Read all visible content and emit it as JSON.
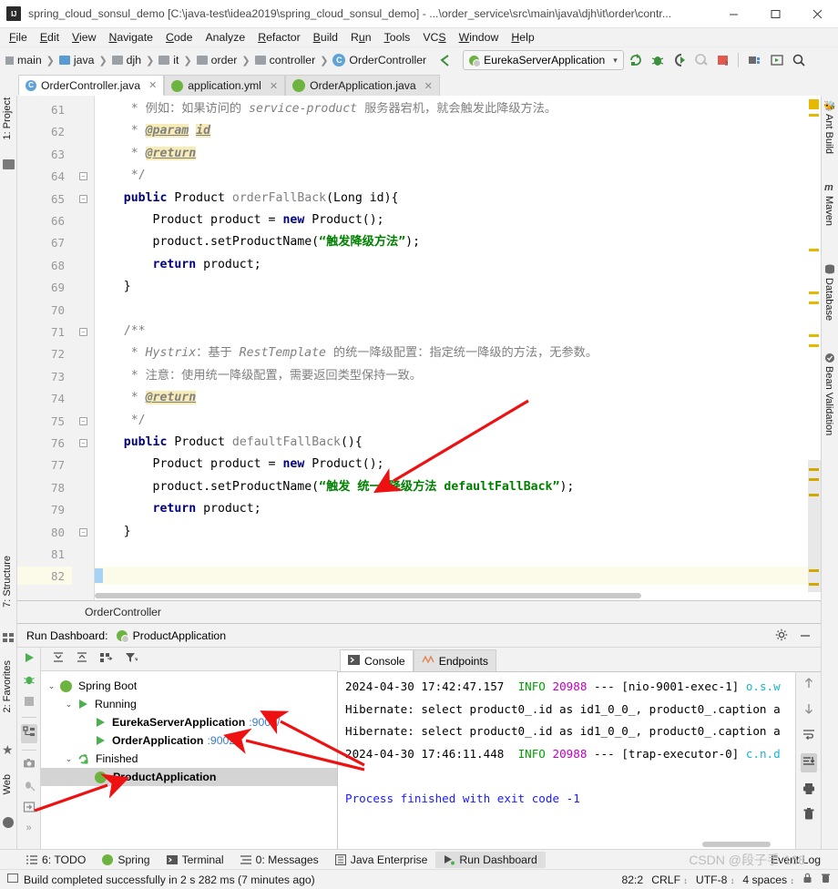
{
  "window": {
    "title": "spring_cloud_sonsul_demo [C:\\java-test\\idea2019\\spring_cloud_sonsul_demo] - ...\\order_service\\src\\main\\java\\djh\\it\\order\\contr...",
    "app_icon": "IJ",
    "minimize": "minimize-icon",
    "maximize": "maximize-icon",
    "close": "close-icon"
  },
  "menubar": [
    "File",
    "Edit",
    "View",
    "Navigate",
    "Code",
    "Analyze",
    "Refactor",
    "Build",
    "Run",
    "Tools",
    "VCS",
    "Window",
    "Help"
  ],
  "breadcrumbs": [
    {
      "label": "main",
      "icon": "module-icon"
    },
    {
      "label": "java",
      "icon": "source-folder-icon"
    },
    {
      "label": "djh",
      "icon": "package-icon"
    },
    {
      "label": "it",
      "icon": "package-icon"
    },
    {
      "label": "order",
      "icon": "package-icon"
    },
    {
      "label": "controller",
      "icon": "package-icon"
    },
    {
      "label": "OrderController",
      "icon": "class-icon"
    }
  ],
  "run_config": {
    "selected": "EurekaServerApplication",
    "caret": "⌄"
  },
  "toolbar_icons": [
    "rerun-icon",
    "debug-icon",
    "run-with-coverage-icon",
    "profile-icon",
    "stop-icon",
    "build-project-icon",
    "run-dashboard-icon",
    "search-everywhere-icon"
  ],
  "editor_tabs": [
    {
      "label": "OrderController.java",
      "icon": "java-class-icon",
      "active": true
    },
    {
      "label": "application.yml",
      "icon": "spring-yaml-icon",
      "active": false
    },
    {
      "label": "OrderApplication.java",
      "icon": "spring-boot-class-icon",
      "active": false
    }
  ],
  "left_rail": [
    {
      "label": "1: Project",
      "icon": "project-icon"
    },
    {
      "label": "7: Structure",
      "icon": "structure-icon"
    },
    {
      "label": "2: Favorites",
      "icon": "star-icon"
    },
    {
      "label": "Web",
      "icon": "web-icon"
    }
  ],
  "right_rail": [
    {
      "label": "Ant Build",
      "icon": "ant-icon"
    },
    {
      "label": "Maven",
      "icon": "maven-icon"
    },
    {
      "label": "Database",
      "icon": "database-icon"
    },
    {
      "label": "Bean Validation",
      "icon": "bean-validation-icon"
    }
  ],
  "editor": {
    "first_line_number": 61,
    "last_line_number": 82,
    "caret_line": 82,
    "lines": [
      {
        "n": 61,
        "segments": [
          {
            "t": "     * ",
            "c": "cm"
          },
          {
            "t": "例如：如果访问的 ",
            "c": "cm"
          },
          {
            "t": "service-product",
            "c": "cmi"
          },
          {
            "t": " 服务器宕机，就会触发此降级方法。",
            "c": "cm"
          }
        ]
      },
      {
        "n": 62,
        "segments": [
          {
            "t": "     * ",
            "c": "cm"
          },
          {
            "t": "@param",
            "c": "tag"
          },
          {
            "t": " ",
            "c": "cm"
          },
          {
            "t": "id",
            "c": "tagb"
          }
        ]
      },
      {
        "n": 63,
        "segments": [
          {
            "t": "     * ",
            "c": "cm"
          },
          {
            "t": "@return",
            "c": "tag"
          }
        ]
      },
      {
        "n": 64,
        "segments": [
          {
            "t": "     */",
            "c": "cm"
          }
        ]
      },
      {
        "n": 65,
        "segments": [
          {
            "t": "    ",
            "c": "id"
          },
          {
            "t": "public",
            "c": "k"
          },
          {
            "t": " Product ",
            "c": "id"
          },
          {
            "t": "orderFallBack",
            "c": "cm"
          },
          {
            "t": "(Long id){",
            "c": "id"
          }
        ]
      },
      {
        "n": 66,
        "segments": [
          {
            "t": "        Product product = ",
            "c": "id"
          },
          {
            "t": "new",
            "c": "k"
          },
          {
            "t": " Product();",
            "c": "id"
          }
        ]
      },
      {
        "n": 67,
        "segments": [
          {
            "t": "        product.setProductName(",
            "c": "id"
          },
          {
            "t": "“触发降级方法”",
            "c": "str"
          },
          {
            "t": ");",
            "c": "id"
          }
        ]
      },
      {
        "n": 68,
        "segments": [
          {
            "t": "        ",
            "c": "id"
          },
          {
            "t": "return",
            "c": "k"
          },
          {
            "t": " product;",
            "c": "id"
          }
        ]
      },
      {
        "n": 69,
        "segments": [
          {
            "t": "    }",
            "c": "id"
          }
        ]
      },
      {
        "n": 70,
        "segments": []
      },
      {
        "n": 71,
        "segments": [
          {
            "t": "    /**",
            "c": "cm"
          }
        ]
      },
      {
        "n": 72,
        "segments": [
          {
            "t": "     * ",
            "c": "cm"
          },
          {
            "t": "Hystrix",
            "c": "cmi"
          },
          {
            "t": "：基于 ",
            "c": "cm"
          },
          {
            "t": "RestTemplate",
            "c": "cmi"
          },
          {
            "t": " 的统一降级配置：指定统一降级的方法，无参数。",
            "c": "cm"
          }
        ]
      },
      {
        "n": 73,
        "segments": [
          {
            "t": "     * 注意：使用统一降级配置，需要返回类型保持一致。",
            "c": "cm"
          }
        ]
      },
      {
        "n": 74,
        "segments": [
          {
            "t": "     * ",
            "c": "cm"
          },
          {
            "t": "@return",
            "c": "tag"
          }
        ]
      },
      {
        "n": 75,
        "segments": [
          {
            "t": "     */",
            "c": "cm"
          }
        ]
      },
      {
        "n": 76,
        "segments": [
          {
            "t": "    ",
            "c": "id"
          },
          {
            "t": "public",
            "c": "k"
          },
          {
            "t": " Product ",
            "c": "id"
          },
          {
            "t": "defaultFallBack",
            "c": "cm"
          },
          {
            "t": "(){",
            "c": "id"
          }
        ]
      },
      {
        "n": 77,
        "segments": [
          {
            "t": "        Product product = ",
            "c": "id"
          },
          {
            "t": "new",
            "c": "k"
          },
          {
            "t": " Product();",
            "c": "id"
          }
        ]
      },
      {
        "n": 78,
        "segments": [
          {
            "t": "        product.setProductName(",
            "c": "id"
          },
          {
            "t": "“触发 统一 降级方法 defaultFallBack”",
            "c": "str"
          },
          {
            "t": ");",
            "c": "id"
          }
        ]
      },
      {
        "n": 79,
        "segments": [
          {
            "t": "        ",
            "c": "id"
          },
          {
            "t": "return",
            "c": "k"
          },
          {
            "t": " product;",
            "c": "id"
          }
        ]
      },
      {
        "n": 80,
        "segments": [
          {
            "t": "    }",
            "c": "id"
          }
        ]
      },
      {
        "n": 81,
        "segments": []
      },
      {
        "n": 82,
        "segments": [
          {
            "t": "}",
            "c": "id"
          }
        ]
      }
    ]
  },
  "editor_breadcrumb": "OrderController",
  "run_dashboard": {
    "title": "Run Dashboard:",
    "subject": "ProductApplication",
    "subject_icon": "spring-boot-icon",
    "settings_icon": "gear-icon",
    "hide_icon": "minimize-icon",
    "side_buttons": [
      "run-icon",
      "debug-icon",
      "stop-icon",
      "show-config-icon",
      "screenshot-icon",
      "debug-attach-icon",
      "export-icon",
      "more-icon"
    ],
    "tree_toolbar": [
      "expand-all-icon",
      "collapse-all-icon",
      "group-by-icon",
      "filter-icon"
    ],
    "tree": [
      {
        "depth": 0,
        "twisty": "⌄",
        "icon": "spring-boot-icon",
        "label": "Spring Boot",
        "bold": false,
        "port": "",
        "selected": false
      },
      {
        "depth": 1,
        "twisty": "⌄",
        "icon": "run-icon",
        "label": "Running",
        "bold": false,
        "port": "",
        "selected": false
      },
      {
        "depth": 2,
        "twisty": "",
        "icon": "run-icon",
        "label": "EurekaServerApplication",
        "bold": true,
        "port": ":9000/",
        "selected": false
      },
      {
        "depth": 2,
        "twisty": "",
        "icon": "run-icon",
        "label": "OrderApplication",
        "bold": true,
        "port": ":9002/",
        "selected": false
      },
      {
        "depth": 1,
        "twisty": "⌄",
        "icon": "rerun-icon",
        "label": "Finished",
        "bold": false,
        "port": "",
        "selected": false
      },
      {
        "depth": 2,
        "twisty": "",
        "icon": "spring-boot-icon",
        "label": "ProductApplication",
        "bold": true,
        "port": "",
        "selected": true
      }
    ],
    "console_tabs": [
      {
        "label": "Console",
        "icon": "console-icon",
        "active": true
      },
      {
        "label": "Endpoints",
        "icon": "endpoints-icon",
        "active": false
      }
    ],
    "console_lines": [
      {
        "segments": [
          {
            "t": "2024-04-30 17:42:47.157  ",
            "c": "plain"
          },
          {
            "t": "INFO",
            "c": "c-info"
          },
          {
            "t": " ",
            "c": "plain"
          },
          {
            "t": "20988",
            "c": "c-pid"
          },
          {
            "t": " --- [nio-9001-exec-1] ",
            "c": "plain"
          },
          {
            "t": "o.s.w",
            "c": "c-cls"
          }
        ]
      },
      {
        "segments": [
          {
            "t": "Hibernate: select product0_.id as id1_0_0_, product0_.caption a",
            "c": "plain"
          }
        ]
      },
      {
        "segments": [
          {
            "t": "Hibernate: select product0_.id as id1_0_0_, product0_.caption a",
            "c": "plain"
          }
        ]
      },
      {
        "segments": [
          {
            "t": "2024-04-30 17:46:11.448  ",
            "c": "plain"
          },
          {
            "t": "INFO",
            "c": "c-info"
          },
          {
            "t": " ",
            "c": "plain"
          },
          {
            "t": "20988",
            "c": "c-pid"
          },
          {
            "t": " --- [trap-executor-0] ",
            "c": "plain"
          },
          {
            "t": "c.n.d",
            "c": "c-cls"
          }
        ]
      },
      {
        "segments": []
      },
      {
        "segments": [
          {
            "t": "Process finished with exit code -1",
            "c": "c-exit"
          }
        ]
      }
    ],
    "console_side_icons": [
      "scroll-up-icon",
      "scroll-down-icon",
      "soft-wrap-icon",
      "scroll-to-end-icon",
      "print-icon",
      "clear-all-icon"
    ]
  },
  "toolwindow_bar": [
    {
      "label": "6: TODO",
      "icon": "todo-icon",
      "active": false
    },
    {
      "label": "Spring",
      "icon": "spring-icon",
      "active": false
    },
    {
      "label": "Terminal",
      "icon": "terminal-icon",
      "active": false
    },
    {
      "label": "0: Messages",
      "icon": "messages-icon",
      "active": false
    },
    {
      "label": "Java Enterprise",
      "icon": "java-enterprise-icon",
      "active": false
    },
    {
      "label": "Run Dashboard",
      "icon": "run-dashboard-icon",
      "active": true
    },
    {
      "label": "Event Log",
      "icon": "event-log-icon",
      "active": false
    }
  ],
  "statusbar": {
    "message": "Build completed successfully in 2 s 282 ms (7 minutes ago)",
    "position": "82:2",
    "line_separator": "CRLF",
    "encoding": "UTF-8",
    "indent": "4 spaces",
    "lock_icon": "lock-icon",
    "trash_icon": "trash-icon"
  },
  "watermark": "CSDN @段子手-168",
  "colors": {
    "accent_green": "#6db33f",
    "keyword_blue": "#000080",
    "string_green": "#008000",
    "arrow_red": "#ee1111",
    "link_blue": "#3a7bd5",
    "stripe_yellow": "#e6b800"
  }
}
